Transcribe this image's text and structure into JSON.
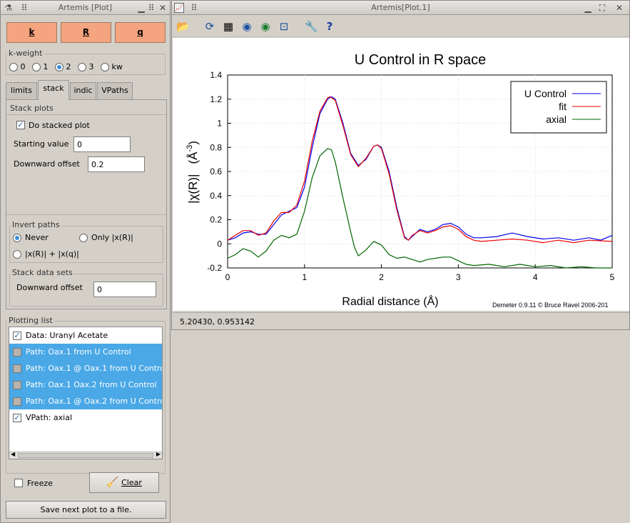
{
  "left_window": {
    "title": "Artemis [Plot]",
    "buttons": {
      "k": "k",
      "r": "R",
      "q": "q"
    },
    "kweight": {
      "label": "k-weight",
      "options": [
        "0",
        "1",
        "2",
        "3",
        "kw"
      ],
      "selected": "2"
    },
    "tabs": [
      "limits",
      "stack",
      "indic",
      "VPaths"
    ],
    "active_tab": "stack",
    "stack_plots": {
      "label": "Stack plots",
      "do_stacked_label": "Do stacked plot",
      "starting_value_label": "Starting value",
      "starting_value": "0",
      "downward_offset_label": "Downward offset",
      "downward_offset": "0.2"
    },
    "invert_paths": {
      "label": "Invert paths",
      "never": "Never",
      "only": "Only |x(R)|",
      "both": "|x(R)| + |x(q)|"
    },
    "stack_data_sets": {
      "label": "Stack data sets",
      "downward_offset_label": "Downward offset",
      "downward_offset": "0"
    },
    "plotting_list": {
      "label": "Plotting list",
      "items": [
        {
          "text": "Data: Uranyl Acetate",
          "checked": true,
          "selected": false
        },
        {
          "text": "Path:  Oax.1  from U Control",
          "checked": false,
          "selected": true
        },
        {
          "text": "Path:  Oax.1 @ Oax.1  from U Control",
          "checked": false,
          "selected": true
        },
        {
          "text": "Path:  Oax.1 Oax.2  from U Control",
          "checked": false,
          "selected": true
        },
        {
          "text": "Path:  Oax.1 @ Oax.2  from U Control",
          "checked": false,
          "selected": true
        },
        {
          "text": "VPath: axial",
          "checked": true,
          "selected": false
        }
      ]
    },
    "freeze_label": "Freeze",
    "clear_label": "Clear",
    "save_label": "Save next plot to a file."
  },
  "right_window": {
    "title": "Artemis[Plot.1]",
    "status": "5.20430,  0.953142",
    "credit": "Demeter 0.9.11 © Bruce Ravel 2006-201"
  },
  "chart_data": {
    "type": "line",
    "title": "U Control in R space",
    "xlabel": "Radial distance   (Å)",
    "ylabel": "|χ(R)|   (Å-3)",
    "ylabel_main": "|χ(R)|",
    "ylabel_unit": "(Å",
    "ylabel_exp": "-3",
    "ylabel_close": ")",
    "xlim": [
      0,
      5
    ],
    "ylim": [
      -0.2,
      1.4
    ],
    "xticks": [
      "0",
      "1",
      "2",
      "3",
      "4",
      "5"
    ],
    "yticks": [
      "-0.2",
      "0",
      "0.2",
      "0.4",
      "0.6",
      "0.8",
      "1",
      "1.2",
      "1.4"
    ],
    "legend_position": "top-right",
    "series": [
      {
        "name": "U Control",
        "color": "#0000ee",
        "points": [
          [
            0,
            0.03
          ],
          [
            0.1,
            0.05
          ],
          [
            0.2,
            0.09
          ],
          [
            0.3,
            0.1
          ],
          [
            0.4,
            0.08
          ],
          [
            0.5,
            0.08
          ],
          [
            0.6,
            0.16
          ],
          [
            0.7,
            0.24
          ],
          [
            0.8,
            0.27
          ],
          [
            0.9,
            0.3
          ],
          [
            1.0,
            0.47
          ],
          [
            1.1,
            0.8
          ],
          [
            1.2,
            1.08
          ],
          [
            1.3,
            1.2
          ],
          [
            1.35,
            1.22
          ],
          [
            1.4,
            1.2
          ],
          [
            1.5,
            1.0
          ],
          [
            1.6,
            0.75
          ],
          [
            1.7,
            0.65
          ],
          [
            1.8,
            0.7
          ],
          [
            1.9,
            0.81
          ],
          [
            1.95,
            0.82
          ],
          [
            2.0,
            0.8
          ],
          [
            2.1,
            0.6
          ],
          [
            2.2,
            0.3
          ],
          [
            2.3,
            0.06
          ],
          [
            2.35,
            0.03
          ],
          [
            2.4,
            0.06
          ],
          [
            2.5,
            0.12
          ],
          [
            2.6,
            0.1
          ],
          [
            2.7,
            0.12
          ],
          [
            2.8,
            0.16
          ],
          [
            2.9,
            0.17
          ],
          [
            3.0,
            0.14
          ],
          [
            3.1,
            0.08
          ],
          [
            3.2,
            0.05
          ],
          [
            3.3,
            0.05
          ],
          [
            3.5,
            0.06
          ],
          [
            3.7,
            0.09
          ],
          [
            3.9,
            0.06
          ],
          [
            4.1,
            0.04
          ],
          [
            4.3,
            0.05
          ],
          [
            4.5,
            0.03
          ],
          [
            4.7,
            0.05
          ],
          [
            4.85,
            0.03
          ],
          [
            5.0,
            0.07
          ]
        ]
      },
      {
        "name": "fit",
        "color": "#ee0000",
        "points": [
          [
            0,
            0.03
          ],
          [
            0.1,
            0.07
          ],
          [
            0.2,
            0.11
          ],
          [
            0.3,
            0.11
          ],
          [
            0.4,
            0.07
          ],
          [
            0.5,
            0.09
          ],
          [
            0.6,
            0.19
          ],
          [
            0.7,
            0.26
          ],
          [
            0.8,
            0.26
          ],
          [
            0.9,
            0.32
          ],
          [
            1.0,
            0.52
          ],
          [
            1.1,
            0.85
          ],
          [
            1.2,
            1.1
          ],
          [
            1.3,
            1.21
          ],
          [
            1.33,
            1.22
          ],
          [
            1.4,
            1.19
          ],
          [
            1.5,
            0.98
          ],
          [
            1.6,
            0.74
          ],
          [
            1.7,
            0.64
          ],
          [
            1.8,
            0.71
          ],
          [
            1.9,
            0.81
          ],
          [
            1.95,
            0.82
          ],
          [
            2.0,
            0.79
          ],
          [
            2.1,
            0.58
          ],
          [
            2.2,
            0.28
          ],
          [
            2.3,
            0.05
          ],
          [
            2.35,
            0.03
          ],
          [
            2.4,
            0.07
          ],
          [
            2.5,
            0.11
          ],
          [
            2.6,
            0.09
          ],
          [
            2.7,
            0.11
          ],
          [
            2.8,
            0.14
          ],
          [
            2.9,
            0.15
          ],
          [
            3.0,
            0.12
          ],
          [
            3.1,
            0.06
          ],
          [
            3.2,
            0.03
          ],
          [
            3.3,
            0.02
          ],
          [
            3.5,
            0.03
          ],
          [
            3.7,
            0.04
          ],
          [
            3.9,
            0.03
          ],
          [
            4.1,
            0.01
          ],
          [
            4.3,
            0.03
          ],
          [
            4.5,
            0.01
          ],
          [
            4.7,
            0.03
          ],
          [
            5.0,
            0.02
          ]
        ]
      },
      {
        "name": "axial",
        "color": "#006600",
        "points": [
          [
            0,
            -0.12
          ],
          [
            0.1,
            -0.09
          ],
          [
            0.2,
            -0.04
          ],
          [
            0.3,
            -0.06
          ],
          [
            0.4,
            -0.11
          ],
          [
            0.5,
            -0.06
          ],
          [
            0.6,
            0.03
          ],
          [
            0.7,
            0.07
          ],
          [
            0.8,
            0.05
          ],
          [
            0.9,
            0.08
          ],
          [
            1.0,
            0.27
          ],
          [
            1.1,
            0.55
          ],
          [
            1.2,
            0.73
          ],
          [
            1.3,
            0.79
          ],
          [
            1.35,
            0.78
          ],
          [
            1.4,
            0.68
          ],
          [
            1.5,
            0.38
          ],
          [
            1.6,
            0.1
          ],
          [
            1.65,
            -0.03
          ],
          [
            1.7,
            -0.1
          ],
          [
            1.8,
            -0.05
          ],
          [
            1.9,
            0.02
          ],
          [
            2.0,
            -0.01
          ],
          [
            2.1,
            -0.09
          ],
          [
            2.2,
            -0.12
          ],
          [
            2.3,
            -0.11
          ],
          [
            2.4,
            -0.13
          ],
          [
            2.5,
            -0.15
          ],
          [
            2.6,
            -0.13
          ],
          [
            2.7,
            -0.12
          ],
          [
            2.8,
            -0.11
          ],
          [
            2.9,
            -0.11
          ],
          [
            3.0,
            -0.14
          ],
          [
            3.1,
            -0.17
          ],
          [
            3.2,
            -0.18
          ],
          [
            3.4,
            -0.17
          ],
          [
            3.6,
            -0.19
          ],
          [
            3.8,
            -0.17
          ],
          [
            4.0,
            -0.19
          ],
          [
            4.2,
            -0.18
          ],
          [
            4.4,
            -0.2
          ],
          [
            4.6,
            -0.19
          ],
          [
            4.8,
            -0.2
          ],
          [
            5.0,
            -0.2
          ]
        ]
      }
    ]
  }
}
